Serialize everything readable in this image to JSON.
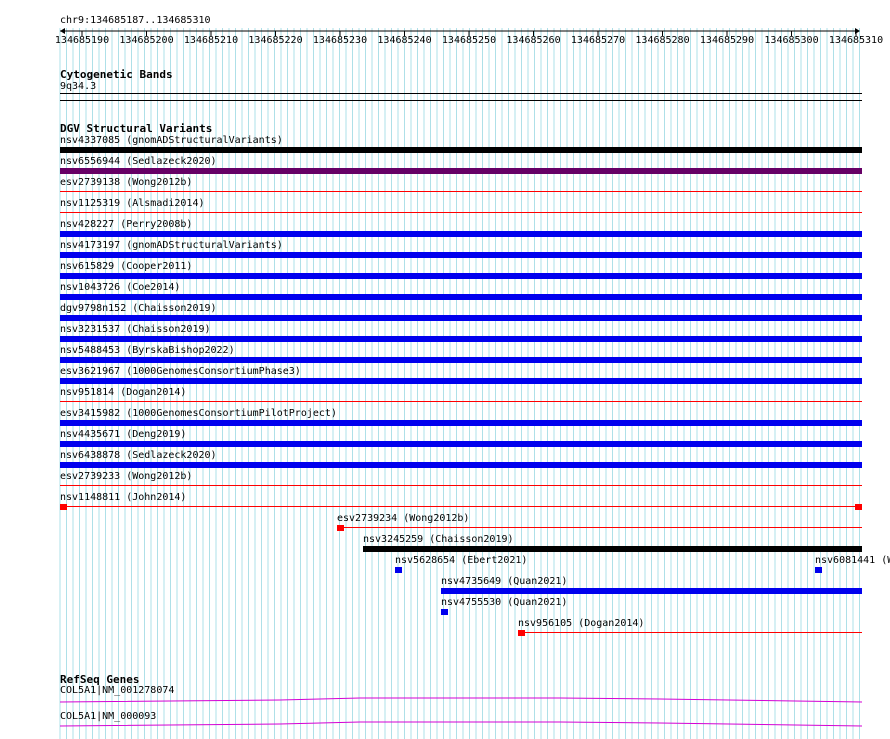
{
  "colors": {
    "black": "#000000",
    "purple": "#660066",
    "blue": "#0000ee",
    "red": "#ff0000",
    "gene": "#d400d4",
    "grid": "#aee0e8"
  },
  "ruler": {
    "range_label": "chr9:134685187..134685310",
    "ticks": [
      "134685190",
      "134685200",
      "134685210",
      "134685220",
      "134685230",
      "134685240",
      "134685250",
      "134685260",
      "134685270",
      "134685280",
      "134685290",
      "134685300",
      "134685310"
    ]
  },
  "cytoband": {
    "title": "Cytogenetic Bands",
    "band": "9q34.3"
  },
  "dgv": {
    "title": "DGV Structural Variants",
    "rows": [
      {
        "label": "nsv4337085 (gnomADStructuralVariants)",
        "color": "black",
        "bar": "thick"
      },
      {
        "label": "nsv6556944 (Sedlazeck2020)",
        "color": "purple",
        "bar": "thick"
      },
      {
        "label": "esv2739138 (Wong2012b)",
        "color": "red",
        "bar": "thin"
      },
      {
        "label": "nsv1125319 (Alsmadi2014)",
        "color": "red",
        "bar": "thin"
      },
      {
        "label": "nsv428227 (Perry2008b)",
        "color": "blue",
        "bar": "thick"
      },
      {
        "label": "nsv4173197 (gnomADStructuralVariants)",
        "color": "blue",
        "bar": "thick"
      },
      {
        "label": "nsv615829 (Cooper2011)",
        "color": "blue",
        "bar": "thick"
      },
      {
        "label": "nsv1043726 (Coe2014)",
        "color": "blue",
        "bar": "thick"
      },
      {
        "label": "dgv9798n152 (Chaisson2019)",
        "color": "blue",
        "bar": "thick"
      },
      {
        "label": "nsv3231537 (Chaisson2019)",
        "color": "blue",
        "bar": "thick"
      },
      {
        "label": "nsv5488453 (ByrskaBishop2022)",
        "color": "blue",
        "bar": "thick"
      },
      {
        "label": "esv3621967 (1000GenomesConsortiumPhase3)",
        "color": "blue",
        "bar": "thick"
      },
      {
        "label": "nsv951814 (Dogan2014)",
        "color": "red",
        "bar": "thin"
      },
      {
        "label": "esv3415982 (1000GenomesConsortiumPilotProject)",
        "color": "blue",
        "bar": "thick"
      },
      {
        "label": "nsv4435671 (Deng2019)",
        "color": "blue",
        "bar": "thick"
      },
      {
        "label": "nsv6438878 (Sedlazeck2020)",
        "color": "blue",
        "bar": "thick"
      },
      {
        "label": "esv2739233 (Wong2012b)",
        "color": "red",
        "bar": "thin"
      },
      {
        "label": "nsv1148811 (John2014)",
        "color": "red",
        "bar": "thin-ends"
      }
    ],
    "stagger": [
      {
        "label": "esv2739234 (Wong2012b)",
        "color": "red",
        "bar": "thin-start"
      },
      {
        "label": "nsv3245259 (Chaisson2019)",
        "color": "black",
        "bar": "thick"
      },
      {
        "label": "nsv5628654 (Ebert2021)",
        "color": "blue",
        "bar": "box"
      },
      {
        "label": "nsv6081441 (W",
        "color": "blue",
        "bar": "box"
      },
      {
        "label": "nsv4735649 (Quan2021)",
        "color": "blue",
        "bar": "thick"
      },
      {
        "label": "nsv4755530 (Quan2021)",
        "color": "blue",
        "bar": "box"
      },
      {
        "label": "nsv956105 (Dogan2014)",
        "color": "red",
        "bar": "thin-start"
      }
    ]
  },
  "refseq": {
    "title": "RefSeq Genes",
    "genes": [
      {
        "label": "COL5A1|NM_001278074"
      },
      {
        "label": "COL5A1|NM_000093"
      }
    ]
  }
}
